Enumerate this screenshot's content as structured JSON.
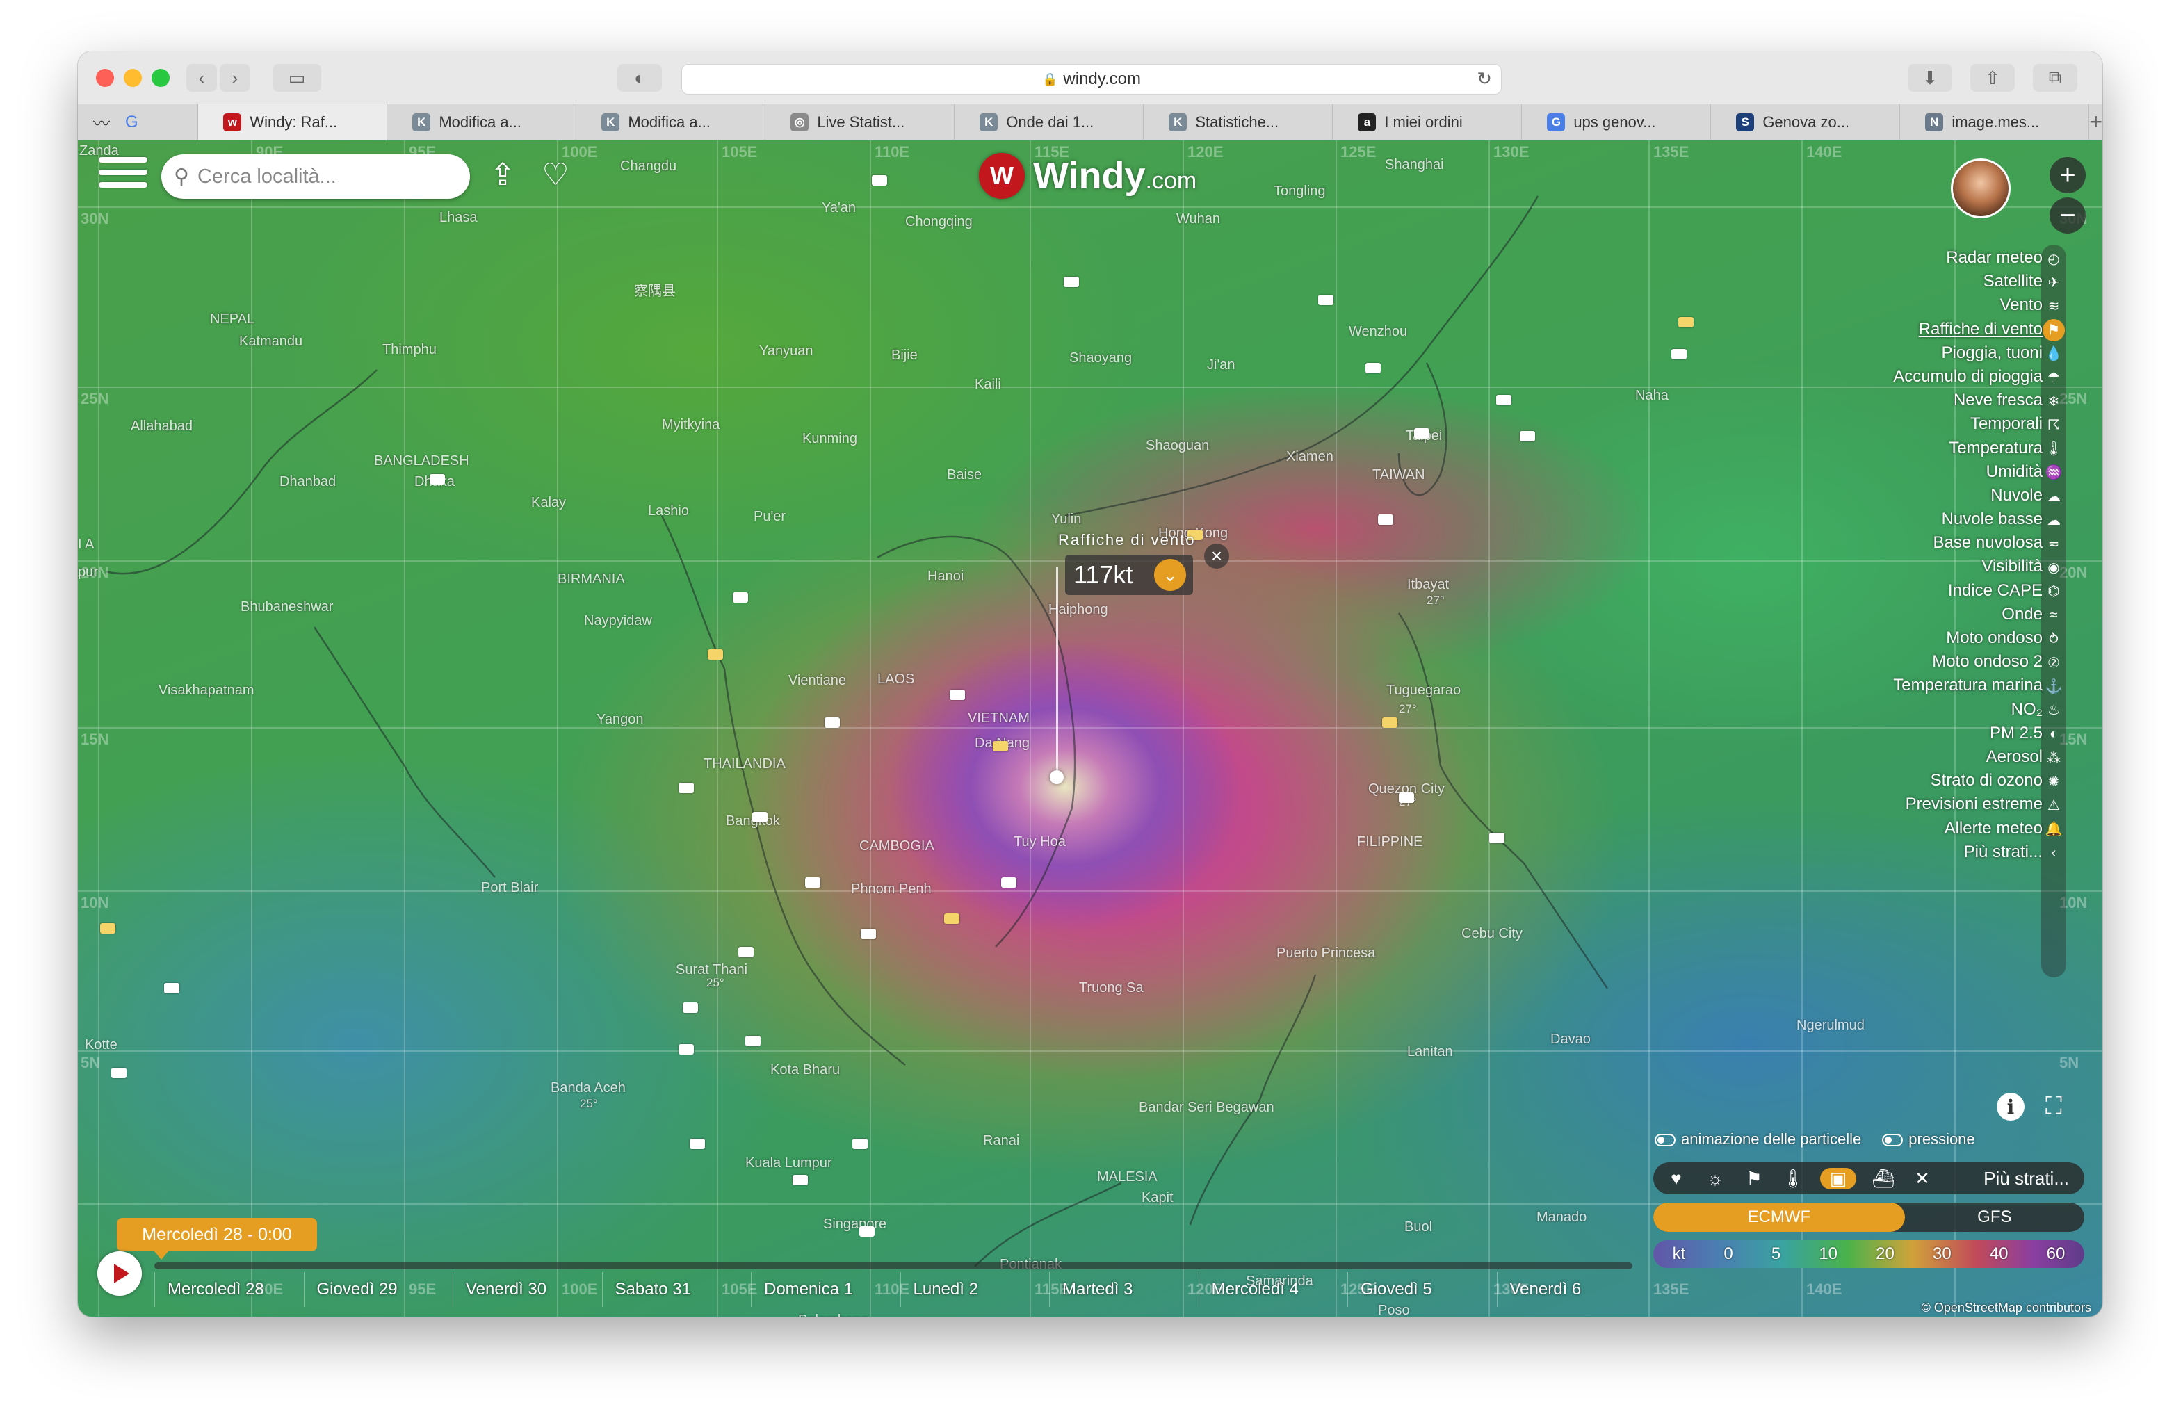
{
  "browser": {
    "url": "windy.com",
    "tabs": [
      {
        "label": "Windy: Raf...",
        "icon": "windy",
        "color": "#c2171d",
        "glyph": "w",
        "active": true
      },
      {
        "label": "Modifica a...",
        "icon": "k",
        "color": "#7a8a96",
        "glyph": "K"
      },
      {
        "label": "Modifica a...",
        "icon": "k",
        "color": "#7a8a96",
        "glyph": "K"
      },
      {
        "label": "Live Statist...",
        "icon": "globe",
        "color": "#8a8a8a",
        "glyph": "◎"
      },
      {
        "label": "Onde dai 1...",
        "icon": "k",
        "color": "#7a8a96",
        "glyph": "K"
      },
      {
        "label": "Statistiche...",
        "icon": "k",
        "color": "#7a8a96",
        "glyph": "K"
      },
      {
        "label": "I miei ordini",
        "icon": "amazon",
        "color": "#222222",
        "glyph": "a"
      },
      {
        "label": "ups genov...",
        "icon": "google",
        "color": "#4a7ee6",
        "glyph": "G"
      },
      {
        "label": "Genova zo...",
        "icon": "s",
        "color": "#1c3f7a",
        "glyph": "S"
      },
      {
        "label": "image.mes...",
        "icon": "n",
        "color": "#6a7a8a",
        "glyph": "N"
      }
    ]
  },
  "windy": {
    "search_placeholder": "Cerca località...",
    "logo_main": "Windy",
    "logo_suffix": ".com",
    "picker": {
      "label": "Raffiche di vento",
      "value": "117kt"
    },
    "layers": [
      {
        "label": "Radar meteo",
        "icon": "radar-icon",
        "glyph": "◴"
      },
      {
        "label": "Satellite",
        "icon": "satellite-icon",
        "glyph": "✈"
      },
      {
        "label": "Vento",
        "icon": "wind-icon",
        "glyph": "≋"
      },
      {
        "label": "Raffiche di vento",
        "icon": "gust-icon",
        "glyph": "⚑",
        "active": true
      },
      {
        "label": "Pioggia, tuoni",
        "icon": "rain-icon",
        "glyph": "💧"
      },
      {
        "label": "Accumulo di pioggia",
        "icon": "rain-accumulation-icon",
        "glyph": "☂"
      },
      {
        "label": "Neve fresca",
        "icon": "snow-icon",
        "glyph": "❄"
      },
      {
        "label": "Temporali",
        "icon": "thunderstorm-icon",
        "glyph": "☈"
      },
      {
        "label": "Temperatura",
        "icon": "thermometer-icon",
        "glyph": "🌡"
      },
      {
        "label": "Umidità",
        "icon": "humidity-icon",
        "glyph": "♒"
      },
      {
        "label": "Nuvole",
        "icon": "cloud-icon",
        "glyph": "☁"
      },
      {
        "label": "Nuvole basse",
        "icon": "low-cloud-icon",
        "glyph": "☁"
      },
      {
        "label": "Base nuvolosa",
        "icon": "cloud-base-icon",
        "glyph": "≂"
      },
      {
        "label": "Visibilità",
        "icon": "eye-icon",
        "glyph": "◉"
      },
      {
        "label": "Indice CAPE",
        "icon": "cape-icon",
        "glyph": "⌬"
      },
      {
        "label": "Onde",
        "icon": "waves-icon",
        "glyph": "≈"
      },
      {
        "label": "Moto ondoso",
        "icon": "swell-icon",
        "glyph": "⥁"
      },
      {
        "label": "Moto ondoso 2",
        "icon": "swell2-icon",
        "glyph": "②"
      },
      {
        "label": "Temperatura marina",
        "icon": "sea-temp-icon",
        "glyph": "⚓"
      },
      {
        "label": "NO₂",
        "icon": "no2-icon",
        "glyph": "♨"
      },
      {
        "label": "PM 2.5",
        "icon": "pm25-icon",
        "glyph": "◐"
      },
      {
        "label": "Aerosol",
        "icon": "aerosol-icon",
        "glyph": "⁂"
      },
      {
        "label": "Strato di ozono",
        "icon": "ozone-icon",
        "glyph": "✺"
      },
      {
        "label": "Previsioni estreme",
        "icon": "warning-icon",
        "glyph": "⚠"
      },
      {
        "label": "Allerte meteo",
        "icon": "alert-icon",
        "glyph": "🔔"
      },
      {
        "label": "Più strati...",
        "icon": "chevron-left-icon",
        "glyph": "‹"
      }
    ],
    "toggles": {
      "particles": "animazione delle particelle",
      "pressure": "pressione"
    },
    "quick_layers_more": "Più strati...",
    "models": [
      "ECMWF",
      "GFS"
    ],
    "legend": {
      "unit": "kt",
      "values": [
        "0",
        "5",
        "10",
        "20",
        "30",
        "40",
        "60"
      ]
    },
    "attribution": "© OpenStreetMap contributors",
    "time_badge": "Mercoledì 28 - 0:00",
    "days": [
      "Mercoledì 28",
      "Giovedì 29",
      "Venerdì 30",
      "Sabato 31",
      "Domenica 1",
      "Lunedì 2",
      "Martedì 3",
      "Mercoledì 4",
      "Giovedì 5",
      "Venerdì 6"
    ],
    "coords": {
      "lon": [
        "90E",
        "95E",
        "100E",
        "105E",
        "110E",
        "115E",
        "120E",
        "125E",
        "130E",
        "135E",
        "140E"
      ],
      "lat": [
        "30N",
        "25N",
        "20N",
        "15N",
        "10N",
        "5N"
      ]
    },
    "places": [
      {
        "name": "Zanda"
      },
      {
        "name": "Changdu"
      },
      {
        "name": "Lhasa"
      },
      {
        "name": "Ya'an"
      },
      {
        "name": "Chongqing"
      },
      {
        "name": "Wuhan"
      },
      {
        "name": "Tongling"
      },
      {
        "name": "Shanghai"
      },
      {
        "name": "察隅县"
      },
      {
        "name": "NEPAL"
      },
      {
        "name": "Katmandu"
      },
      {
        "name": "Thimphu"
      },
      {
        "name": "Yanyuan"
      },
      {
        "name": "Bijie"
      },
      {
        "name": "Shaoyang"
      },
      {
        "name": "Ji'an"
      },
      {
        "name": "Wenzhou"
      },
      {
        "name": "Kaili"
      },
      {
        "name": "Allahabad"
      },
      {
        "name": "Myitkyina"
      },
      {
        "name": "Kunming"
      },
      {
        "name": "Shaoguan"
      },
      {
        "name": "Xiamen"
      },
      {
        "name": "Taipei"
      },
      {
        "name": "Naha"
      },
      {
        "name": "BANGLADESH"
      },
      {
        "name": "Dhanbad"
      },
      {
        "name": "Dhaka"
      },
      {
        "name": "Kalay"
      },
      {
        "name": "Lashio"
      },
      {
        "name": "Baise"
      },
      {
        "name": "Pu'er"
      },
      {
        "name": "Yulin"
      },
      {
        "name": "Hong Kong"
      },
      {
        "name": "TAIWAN"
      },
      {
        "name": "BIRMANIA"
      },
      {
        "name": "Hanoi"
      },
      {
        "name": "Itbayat"
      },
      {
        "name": "Bhubaneshwar"
      },
      {
        "name": "Naypyidaw"
      },
      {
        "name": "Haiphong"
      },
      {
        "name": "Vientiane"
      },
      {
        "name": "LAOS"
      },
      {
        "name": "VIETNAM"
      },
      {
        "name": "Tuguegarao"
      },
      {
        "name": "Visakhapatnam"
      },
      {
        "name": "Yangon"
      },
      {
        "name": "Da Nang"
      },
      {
        "name": "THAILANDIA"
      },
      {
        "name": "Quezon City"
      },
      {
        "name": "Bangkok"
      },
      {
        "name": "Tuy Hoa"
      },
      {
        "name": "CAMBOGIA"
      },
      {
        "name": "FILIPPINE"
      },
      {
        "name": "Port Blair"
      },
      {
        "name": "Phnom Penh"
      },
      {
        "name": "Cebu City"
      },
      {
        "name": "Puerto Princesa"
      },
      {
        "name": "Surat Thani"
      },
      {
        "name": "Truong Sa"
      },
      {
        "name": "Ngerulmud"
      },
      {
        "name": "Kotte"
      },
      {
        "name": "Kota Bharu"
      },
      {
        "name": "Lanitan"
      },
      {
        "name": "Davao"
      },
      {
        "name": "Banda Aceh"
      },
      {
        "name": "Bandar Seri Begawan"
      },
      {
        "name": "Ranai"
      },
      {
        "name": "Kuala Lumpur"
      },
      {
        "name": "MALESIA"
      },
      {
        "name": "Kapit"
      },
      {
        "name": "Manado"
      },
      {
        "name": "Singapore"
      },
      {
        "name": "Buol"
      },
      {
        "name": "Pontianak"
      },
      {
        "name": "Samarinda"
      },
      {
        "name": "Poso"
      },
      {
        "name": "Palembang"
      },
      {
        "name": "I A"
      },
      {
        "name": "pur"
      }
    ],
    "temps": [
      "27°",
      "27°",
      "27°",
      "25°",
      "25°"
    ]
  }
}
